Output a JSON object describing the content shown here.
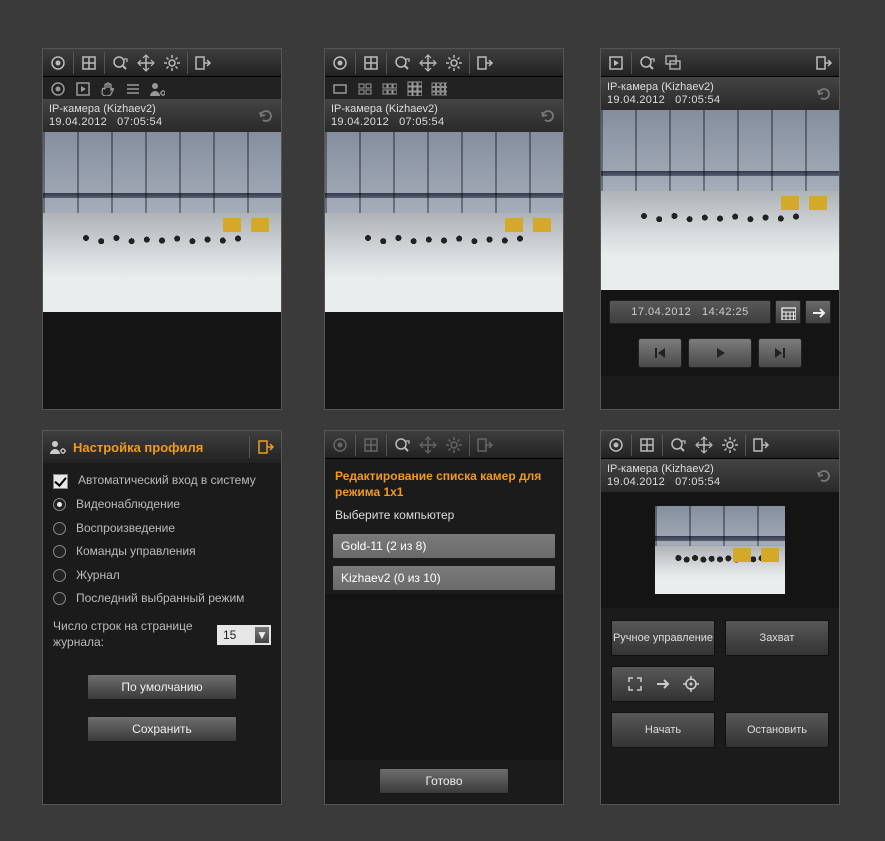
{
  "cam": {
    "title": "IP-камера (Kizhaev2)",
    "date": "19.04.2012",
    "time": "07:05:54"
  },
  "playback": {
    "date": "17.04.2012",
    "time": "14:42:25"
  },
  "profile": {
    "title": "Настройка профиля",
    "auto_login": "Автоматический вход в систему",
    "modes": {
      "video": "Видеонаблюдение",
      "play": "Воспроизведение",
      "commands": "Команды управления",
      "journal": "Журнал",
      "last": "Последний выбранный режим"
    },
    "lines_label": "Число строк на странице журнала:",
    "lines_value": "15",
    "default_btn": "По умолчанию",
    "save_btn": "Сохранить"
  },
  "edit": {
    "title": "Редактирование списка камер для режима 1x1",
    "subtitle": "Выберите компьютер",
    "items": {
      "gold": "Gold-11 (2 из 8)",
      "kizh": "Kizhaev2 (0 из 10)"
    },
    "done": "Готово"
  },
  "control": {
    "manual": "Ручное управление",
    "capture": "Захват",
    "start": "Начать",
    "stop": "Остановить"
  }
}
